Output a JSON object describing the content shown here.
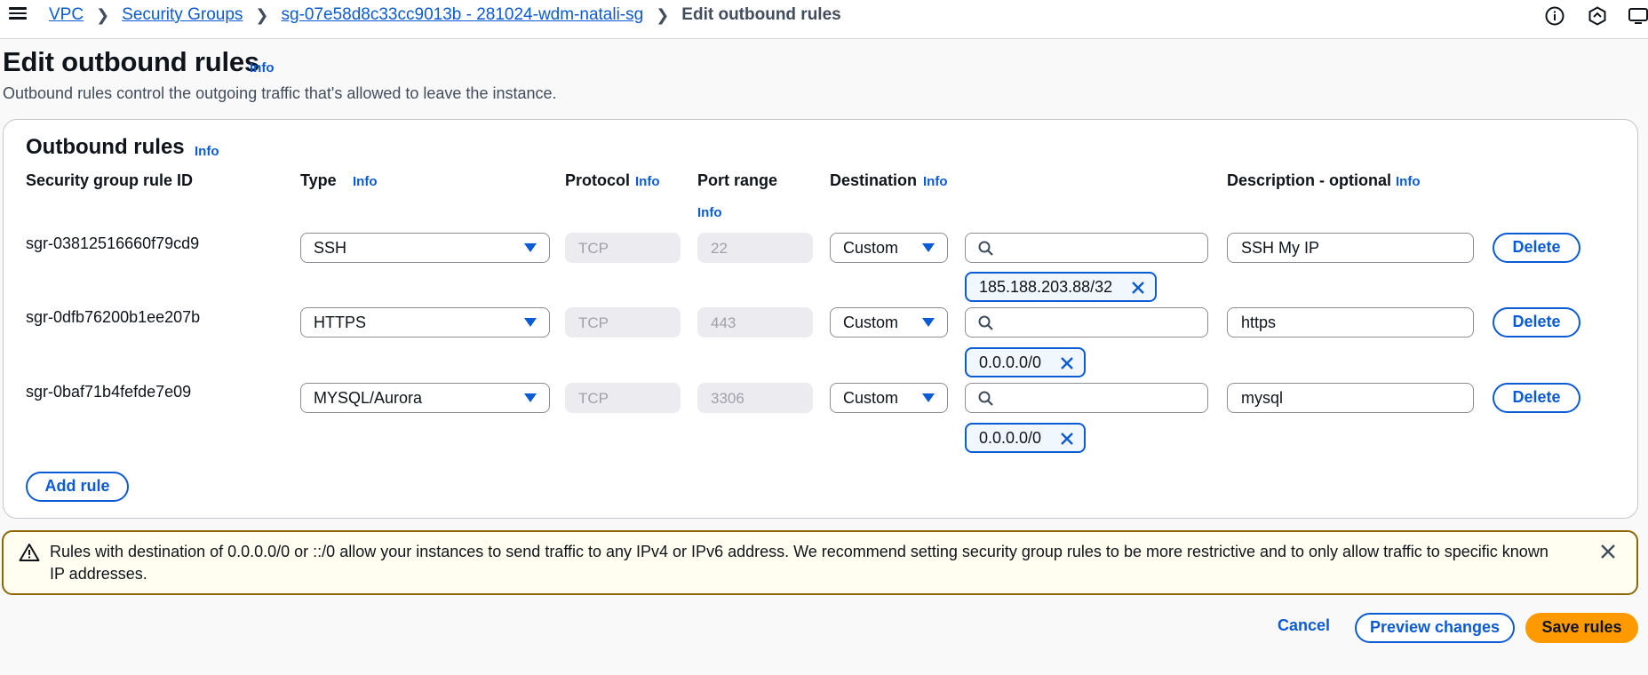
{
  "breadcrumb": {
    "items": [
      "VPC",
      "Security Groups",
      "sg-07e58d8c33cc9013b - 281024-wdm-natali-sg"
    ],
    "current": "Edit outbound rules"
  },
  "header": {
    "title": "Edit outbound rules",
    "info": "Info",
    "description": "Outbound rules control the outgoing traffic that's allowed to leave the instance."
  },
  "panel": {
    "title": "Outbound rules",
    "info": "Info",
    "columns": {
      "rule_id": "Security group rule ID",
      "type": "Type",
      "protocol": "Protocol",
      "port_range": "Port range",
      "destination": "Destination",
      "description": "Description - optional",
      "info": "Info"
    },
    "rules": [
      {
        "id": "sgr-03812516660f79cd9",
        "type": "SSH",
        "protocol": "TCP",
        "port": "22",
        "dest_type": "Custom",
        "cidr": "185.188.203.88/32",
        "description": "SSH My IP",
        "delete": "Delete"
      },
      {
        "id": "sgr-0dfb76200b1ee207b",
        "type": "HTTPS",
        "protocol": "TCP",
        "port": "443",
        "dest_type": "Custom",
        "cidr": "0.0.0.0/0",
        "description": "https",
        "delete": "Delete"
      },
      {
        "id": "sgr-0baf71b4fefde7e09",
        "type": "MYSQL/Aurora",
        "protocol": "TCP",
        "port": "3306",
        "dest_type": "Custom",
        "cidr": "0.0.0.0/0",
        "description": "mysql",
        "delete": "Delete"
      }
    ],
    "add_rule": "Add rule"
  },
  "alert": {
    "message": "Rules with destination of 0.0.0.0/0 or ::/0 allow your instances to send traffic to any IPv4 or IPv6 address. We recommend setting security group rules to be more restrictive and to only allow traffic to specific known IP addresses."
  },
  "footer": {
    "cancel": "Cancel",
    "preview": "Preview changes",
    "save": "Save rules"
  },
  "icons": {
    "menu": "hamburger-menu-icon",
    "info": "info-circle-icon",
    "notifications": "notifications-icon",
    "screen": "screen-icon",
    "search": "search-icon",
    "remove": "close-icon",
    "warning": "warning-icon"
  },
  "colors": {
    "link": "#0b5ad6",
    "primary": "#ff9900",
    "warning_border": "#8d6605",
    "warning_bg": "#fffef0"
  }
}
